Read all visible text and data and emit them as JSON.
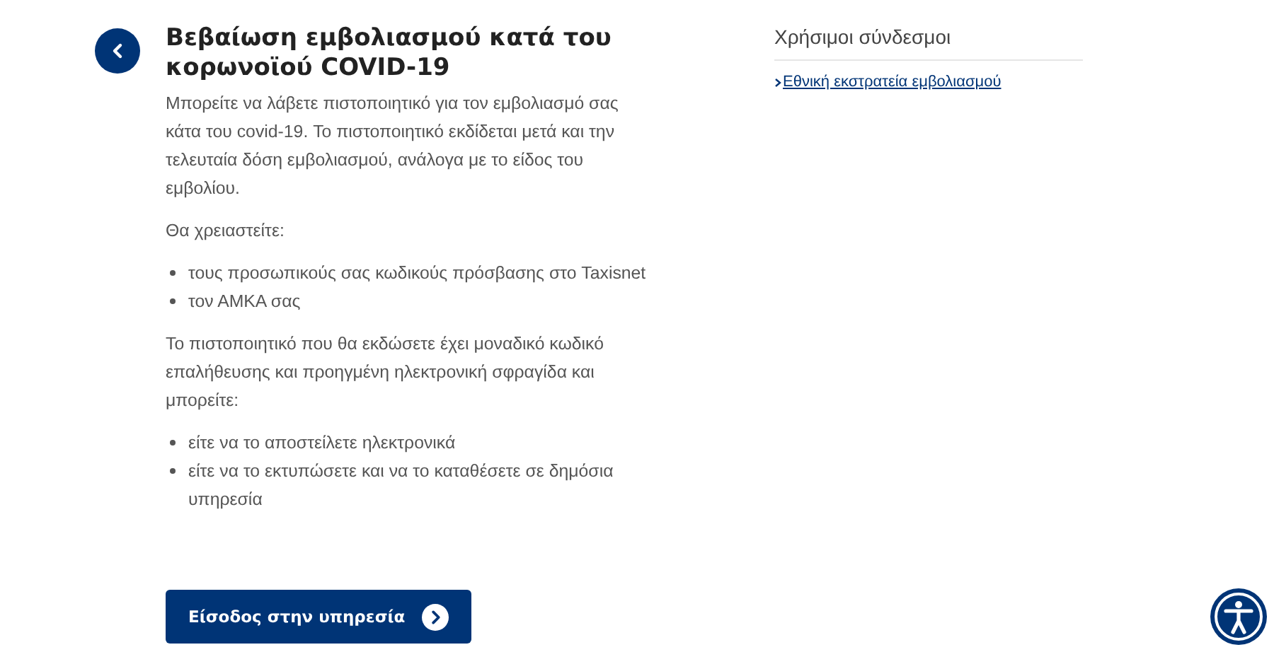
{
  "article": {
    "title": "Βεβαίωση εμβολιασμού κατά του κορωνοϊού COVID-19",
    "blocks": [
      {
        "kind": "paragraph",
        "text": "Μπορείτε να λάβετε πιστοποιητικό για τον εμβολιασμό σας κάτα του covid-19. Το πιστοποιητικό εκδίδεται μετά και την τελευταία δόση εμβολιασμού, ανάλογα με το είδος του εμβολίου."
      },
      {
        "kind": "paragraph",
        "text": "Θα χρειαστείτε:"
      },
      {
        "kind": "list",
        "items": [
          "τους προσωπικούς σας κωδικούς πρόσβασης στο Taxisnet",
          "τον ΑΜΚΑ σας"
        ]
      },
      {
        "kind": "paragraph",
        "text": "Το πιστοποιητικό που θα εκδώσετε έχει μοναδικό κωδικό επαλήθευσης και προηγμένη ηλεκτρονική σφραγίδα και μπορείτε:"
      },
      {
        "kind": "list",
        "items": [
          "είτε να το αποστείλετε ηλεκτρονικά",
          "είτε να το εκτυπώσετε και να το καταθέσετε σε δημόσια υπηρεσία"
        ]
      }
    ],
    "button": "Είσοδος στην υπηρεσία"
  },
  "sidebar": {
    "title": "Χρήσιμοι σύνδεσμοι",
    "links": [
      "Εθνική εκστρατεία εμβολιασμού"
    ]
  }
}
